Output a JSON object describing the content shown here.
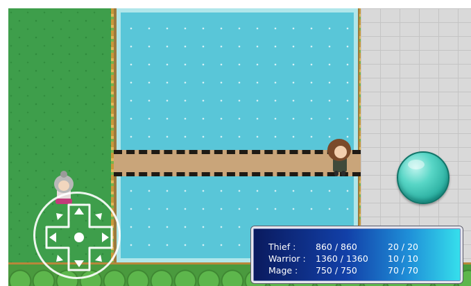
{
  "status_window": {
    "members": [
      {
        "name": "Thief :",
        "hp": "860 / 860",
        "mp": "20 / 20"
      },
      {
        "name": "Warrior :",
        "hp": "1360 / 1360",
        "mp": "10 / 10"
      },
      {
        "name": "Mage :",
        "hp": "750 / 750",
        "mp": "70 / 70"
      }
    ]
  },
  "colors": {
    "grass": "#3e9e4b",
    "water": "#59c6d8",
    "bridge": "#c9a57a",
    "wall": "#d9d9d9",
    "action_button": "#58d6c6",
    "status_gradient_start": "#0a1a5e",
    "status_gradient_end": "#36e0ec"
  },
  "icons": {
    "joystick": "dpad-icon",
    "action_button": "circle-button-icon"
  }
}
